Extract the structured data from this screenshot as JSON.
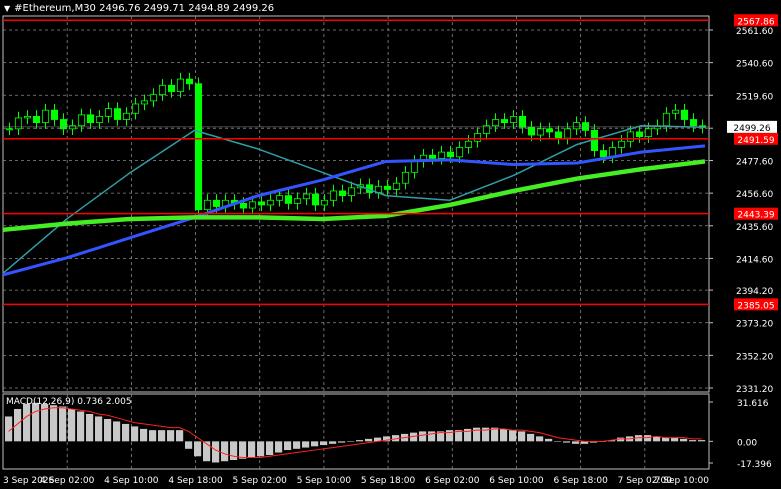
{
  "header": {
    "symbol": "#Ethereum,M30",
    "open": "2496.76",
    "high": "2499.71",
    "low": "2494.89",
    "close": "2499.26"
  },
  "macd_header": "MACD(12,26,9) 0.736 2.005",
  "colors": {
    "background": "#000000",
    "grid": "#8a8a8a",
    "candle": "#00ff00",
    "level_line": "#ff0000",
    "ma_fast": "#2e9ea8",
    "ma_mid": "#3355ff",
    "ma_slow": "#44ee22",
    "macd_hist": "#c8c8c8",
    "macd_signal": "#ff2020"
  },
  "chart_data": {
    "type": "candlestick",
    "price_axis_ticks": [
      "2561.60",
      "2540.60",
      "2519.60",
      "2498.40",
      "2477.60",
      "2456.60",
      "2435.60",
      "2414.60",
      "2394.20",
      "2373.20",
      "2352.20",
      "2331.20"
    ],
    "y_range": [
      2331.2,
      2561.6
    ],
    "time_axis_ticks": [
      "3 Sep 2026",
      "4 Sep 02:00",
      "4 Sep 10:00",
      "4 Sep 18:00",
      "5 Sep 02:00",
      "5 Sep 10:00",
      "5 Sep 18:00",
      "6 Sep 02:00",
      "6 Sep 10:00",
      "6 Sep 18:00",
      "7 Sep 02:00",
      "7 Sep 10:00"
    ],
    "horizontal_levels": [
      {
        "price": 2567.86,
        "label": "2567.86"
      },
      {
        "price": 2491.59,
        "label": "2491.59"
      },
      {
        "price": 2443.39,
        "label": "2443.39"
      },
      {
        "price": 2385.05,
        "label": "2385.05"
      }
    ],
    "current_price": {
      "price": 2499.26,
      "label": "2499.26"
    },
    "close_series": [
      2498,
      2505,
      2506,
      2502,
      2510,
      2504,
      2498,
      2500,
      2507,
      2502,
      2506,
      2511,
      2504,
      2508,
      2514,
      2516,
      2520,
      2526,
      2522,
      2530,
      2527,
      2446,
      2452,
      2448,
      2452,
      2450,
      2447,
      2451,
      2449,
      2452,
      2455,
      2450,
      2453,
      2456,
      2449,
      2452,
      2458,
      2455,
      2460,
      2462,
      2457,
      2461,
      2459,
      2463,
      2470,
      2477,
      2481,
      2479,
      2483,
      2480,
      2486,
      2490,
      2495,
      2500,
      2504,
      2502,
      2506,
      2499,
      2494,
      2498,
      2496,
      2492,
      2498,
      2502,
      2497,
      2484,
      2480,
      2486,
      2490,
      2496,
      2493,
      2498,
      2500,
      2508,
      2510,
      2504,
      2500,
      2499
    ],
    "ma_fast": [
      2405,
      2440,
      2470,
      2497,
      2485,
      2470,
      2455,
      2452,
      2468,
      2488,
      2500,
      2499
    ],
    "ma_mid": [
      2404,
      2415,
      2428,
      2441,
      2455,
      2465,
      2477,
      2478,
      2475,
      2476,
      2483,
      2487
    ],
    "ma_slow": [
      2433,
      2437,
      2440,
      2441,
      2441,
      2440,
      2442,
      2449,
      2458,
      2466,
      2472,
      2477
    ],
    "macd": {
      "axis_ticks": [
        "31.616",
        "0.00",
        "-17.396"
      ],
      "range": [
        -17.396,
        31.616
      ],
      "histogram": [
        20,
        26,
        30,
        31,
        30,
        29,
        28,
        26,
        24,
        22,
        20,
        18,
        16,
        14,
        12,
        10,
        9,
        9,
        9,
        9,
        -6,
        -12,
        -16,
        -17,
        -16,
        -15,
        -14,
        -13,
        -12,
        -11,
        -9,
        -7,
        -6,
        -5,
        -4,
        -3,
        -2,
        -1,
        0,
        1,
        2,
        3,
        4,
        5,
        6,
        7,
        8,
        8,
        8,
        9,
        9,
        10,
        11,
        11,
        11,
        10,
        9,
        8,
        6,
        4,
        2,
        0,
        -1,
        -2,
        -2,
        -1,
        0,
        1,
        3,
        4,
        5,
        5,
        4,
        3,
        3,
        2,
        1,
        1
      ],
      "signal": [
        8,
        14,
        20,
        24,
        26,
        27,
        27,
        26,
        25,
        24,
        22,
        21,
        19,
        17,
        15,
        14,
        13,
        12,
        11,
        11,
        8,
        3,
        -2,
        -7,
        -10,
        -12,
        -13,
        -13,
        -13,
        -12,
        -11,
        -10,
        -9,
        -8,
        -7,
        -6,
        -5,
        -4,
        -3,
        -2,
        -1,
        0,
        1,
        2,
        3,
        4,
        5,
        6,
        7,
        7,
        8,
        8,
        9,
        9,
        10,
        10,
        9,
        9,
        8,
        7,
        5,
        3,
        2,
        1,
        0,
        0,
        0,
        1,
        2,
        2,
        3,
        3,
        4,
        3,
        3,
        3,
        2,
        2
      ]
    }
  }
}
